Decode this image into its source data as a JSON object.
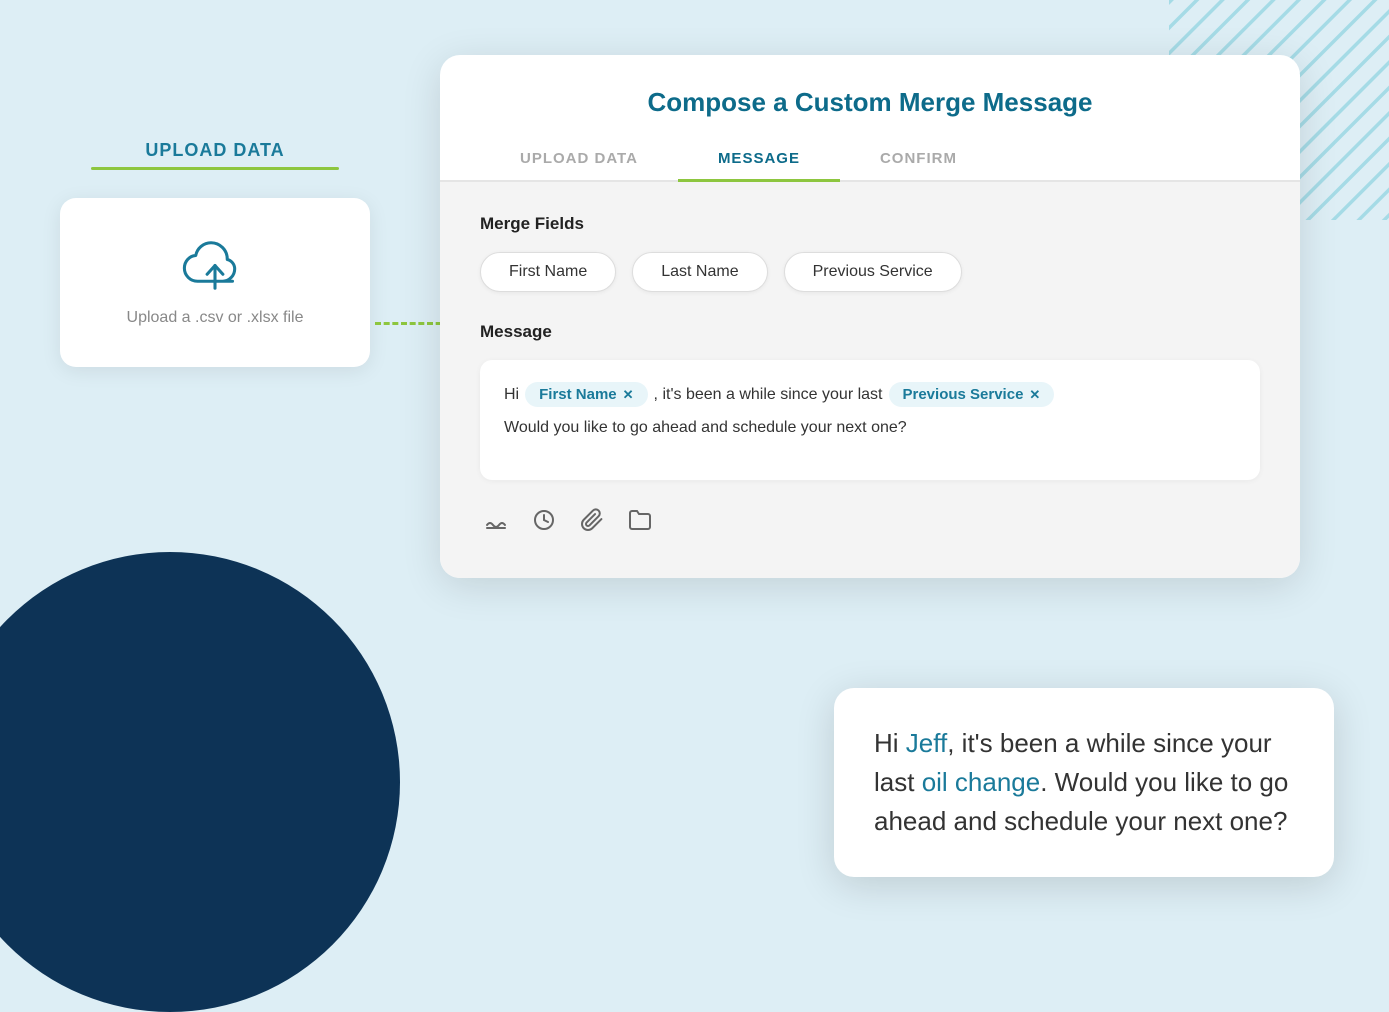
{
  "left_panel": {
    "label": "UPLOAD DATA",
    "upload_text": "Upload a .csv or .xlsx file"
  },
  "modal": {
    "title": "Compose a Custom Merge Message",
    "tabs": [
      {
        "label": "UPLOAD DATA",
        "active": false
      },
      {
        "label": "MESSAGE",
        "active": true
      },
      {
        "label": "CONFIRM",
        "active": false
      }
    ],
    "merge_fields": {
      "section_label": "Merge Fields",
      "fields": [
        "First Name",
        "Last Name",
        "Previous Service"
      ]
    },
    "message": {
      "section_label": "Message",
      "line1_prefix": "Hi",
      "tag1": "First Name",
      "line1_middle": ", it's been a while since your last",
      "tag2": "Previous Service",
      "line2": "Would you like to go ahead and schedule your next one?"
    }
  },
  "preview": {
    "text_before_name": "Hi ",
    "name": "Jeff",
    "text_after_name": ", it's been a while since your last ",
    "service": "oil change",
    "text_end": ". Would you like to go ahead and schedule your next one?"
  },
  "icons": {
    "signature": "✏️",
    "clock": "🕐",
    "paperclip": "📎",
    "folder": "📁"
  }
}
